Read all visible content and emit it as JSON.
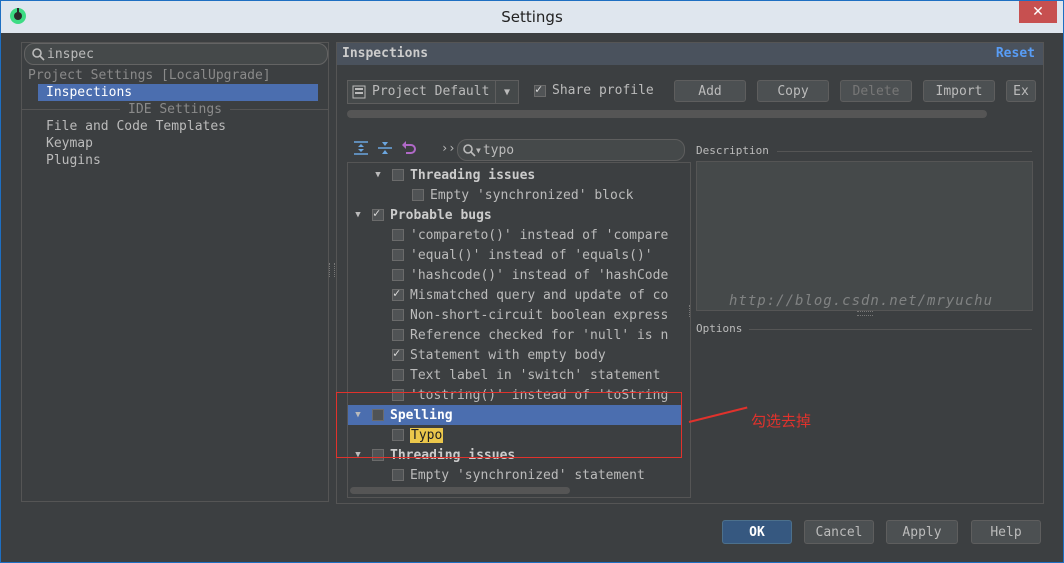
{
  "window": {
    "title": "Settings",
    "close": "✕"
  },
  "search": {
    "value": "inspec"
  },
  "tree": {
    "project_settings": "Project Settings [LocalUpgrade]",
    "selected": "Inspections",
    "ide_settings": "IDE Settings",
    "items": [
      "File and Code Templates",
      "Keymap",
      "Plugins"
    ]
  },
  "panel": {
    "title": "Inspections",
    "reset": "Reset",
    "profile": "Project Default",
    "share_profile": "Share profile",
    "buttons": [
      "Add",
      "Copy",
      "Delete",
      "Import",
      "Ex"
    ]
  },
  "filter": {
    "value": "typo"
  },
  "inspections": [
    {
      "level": 1,
      "expander": "▼",
      "checked": false,
      "label": "Threading issues",
      "header": true
    },
    {
      "level": 2,
      "expander": "",
      "checked": false,
      "label": "Empty 'synchronized' block",
      "header": false
    },
    {
      "level": 0,
      "expander": "▼",
      "checked": true,
      "label": "Probable bugs",
      "header": true
    },
    {
      "level": 1,
      "expander": "",
      "checked": false,
      "label": "'compareto()' instead of 'compare",
      "header": false
    },
    {
      "level": 1,
      "expander": "",
      "checked": false,
      "label": "'equal()' instead of 'equals()'",
      "header": false
    },
    {
      "level": 1,
      "expander": "",
      "checked": false,
      "label": "'hashcode()' instead of 'hashCode",
      "header": false
    },
    {
      "level": 1,
      "expander": "",
      "checked": true,
      "label": "Mismatched query and update of co",
      "header": false
    },
    {
      "level": 1,
      "expander": "",
      "checked": false,
      "label": "Non-short-circuit boolean express",
      "header": false
    },
    {
      "level": 1,
      "expander": "",
      "checked": false,
      "label": "Reference checked for 'null' is n",
      "header": false
    },
    {
      "level": 1,
      "expander": "",
      "checked": true,
      "label": "Statement with empty body",
      "header": false
    },
    {
      "level": 1,
      "expander": "",
      "checked": false,
      "label": "Text label in 'switch' statement",
      "header": false
    },
    {
      "level": 1,
      "expander": "",
      "checked": false,
      "label": "'tostring()' instead of 'toString",
      "header": false
    },
    {
      "level": 0,
      "expander": "▼",
      "checked": false,
      "label": "Spelling",
      "header": true,
      "selected": true
    },
    {
      "level": 1,
      "expander": "",
      "checked": false,
      "label": "Typo",
      "header": false,
      "highlight": true
    },
    {
      "level": 0,
      "expander": "▼",
      "checked": false,
      "label": "Threading issues",
      "header": true
    },
    {
      "level": 1,
      "expander": "",
      "checked": false,
      "label": "Empty 'synchronized' statement",
      "header": false
    }
  ],
  "description_label": "Description",
  "options_label": "Options",
  "watermark": "http://blog.csdn.net/mryuchu",
  "annotation": "勾选去掉",
  "footer": {
    "ok": "OK",
    "cancel": "Cancel",
    "apply": "Apply",
    "help": "Help"
  },
  "colors": {
    "selection": "#4b6eaf",
    "highlight": "#ebc74b",
    "annotation": "#e0322c",
    "link": "#589df6"
  }
}
